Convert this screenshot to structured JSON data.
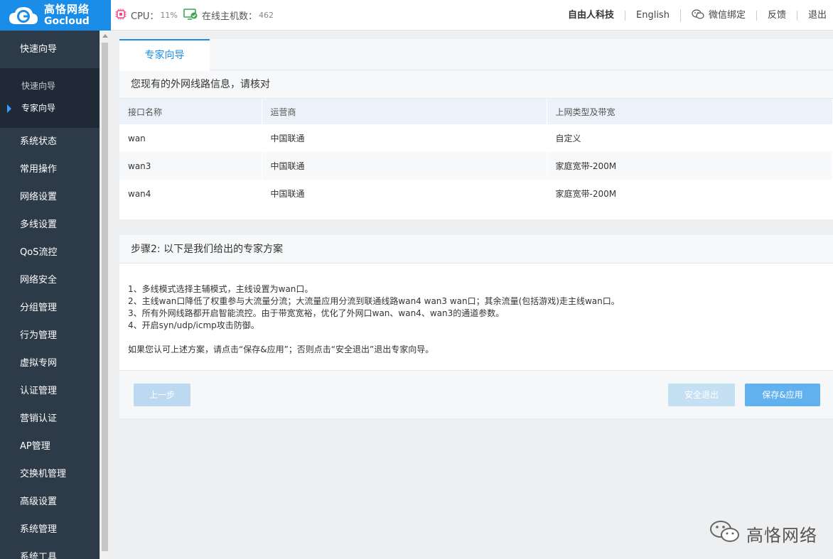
{
  "logo": {
    "cn": "高恪网络",
    "en": "Gocloud"
  },
  "status": {
    "cpu_label": "CPU：",
    "cpu_value": "11%",
    "hosts_label": "在线主机数：",
    "hosts_value": "462"
  },
  "topnav": [
    "自由人科技",
    "English",
    "微信绑定",
    "反馈",
    "退出"
  ],
  "sidebar": {
    "head": "快速向导",
    "sub": [
      "快速向导",
      "专家向导"
    ],
    "items": [
      "系统状态",
      "常用操作",
      "网络设置",
      "多线设置",
      "QoS流控",
      "网络安全",
      "分组管理",
      "行为管理",
      "虚拟专网",
      "认证管理",
      "营销认证",
      "AP管理",
      "交换机管理",
      "高级设置",
      "系统管理",
      "系统工具"
    ]
  },
  "tab": "专家向导",
  "lines_panel": {
    "title": "您现有的外网线路信息，请核对",
    "columns": [
      "接口名称",
      "运营商",
      "上网类型及带宽"
    ],
    "rows": [
      [
        "wan",
        "中国联通",
        "自定义"
      ],
      [
        "wan3",
        "中国联通",
        "家庭宽带-200M"
      ],
      [
        "wan4",
        "中国联通",
        "家庭宽带-200M"
      ]
    ]
  },
  "plan_panel": {
    "title": "步骤2: 以下是我们给出的专家方案",
    "steps": [
      "1、多线模式选择主辅模式，主线设置为wan口。",
      "2、主线wan口降低了权重参与大流量分流；大流量应用分流到联通线路wan4 wan3 wan口；其余流量(包括游戏)走主线wan口。",
      "3、所有外网线路都开启智能流控。由于带宽宽裕，优化了外网口wan、wan4、wan3的通道参数。",
      "4、开启syn/udp/icmp攻击防御。"
    ],
    "note": "如果您认可上述方案，请点击“保存&应用”；否则点击“安全退出”退出专家向导。"
  },
  "buttons": {
    "prev": "上一步",
    "exit": "安全退出",
    "save": "保存&应用"
  },
  "watermark": "高恪网络",
  "colors": {
    "brand": "#1a8de9",
    "sidebar": "#2d3a48",
    "save": "#62b1ef"
  }
}
